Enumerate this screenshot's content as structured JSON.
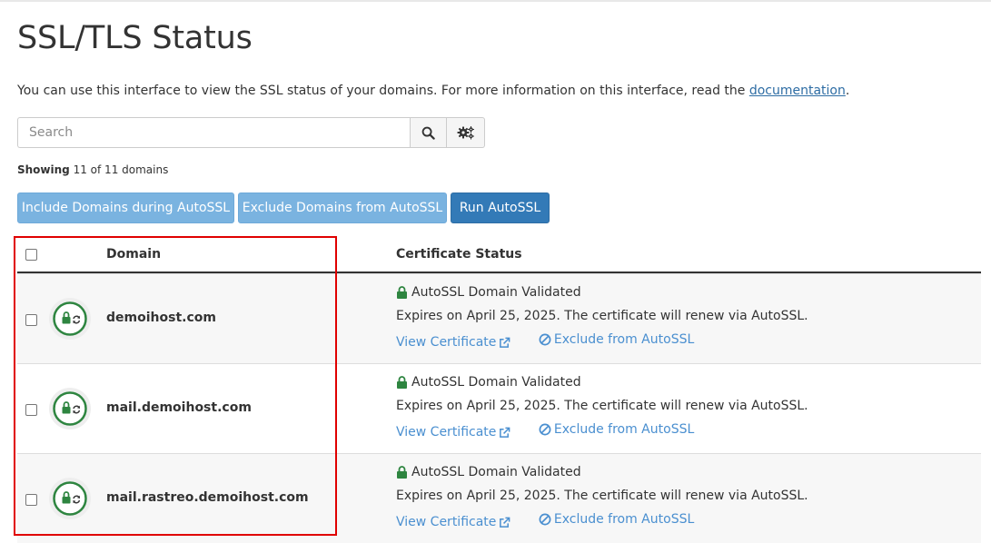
{
  "page": {
    "title": "SSL/TLS Status",
    "intro_text": "You can use this interface to view the SSL status of your domains. For more information on this interface, read the ",
    "intro_link": "documentation",
    "intro_end": "."
  },
  "search": {
    "placeholder": "Search",
    "search_icon": "search-icon",
    "settings_icon": "gears-icon"
  },
  "showing": {
    "label": "Showing",
    "count_text": "11 of 11 domains"
  },
  "actions": {
    "include": "Include Domains during AutoSSL",
    "exclude": "Exclude Domains from AutoSSL",
    "run": "Run AutoSSL"
  },
  "table": {
    "col_domain": "Domain",
    "col_status": "Certificate Status",
    "rows": [
      {
        "domain": "demoihost.com",
        "status": "AutoSSL Domain Validated",
        "expires": "Expires on April 25, 2025. The certificate will renew via AutoSSL.",
        "view_link": "View Certificate",
        "exclude_link": "Exclude from AutoSSL"
      },
      {
        "domain": "mail.demoihost.com",
        "status": "AutoSSL Domain Validated",
        "expires": "Expires on April 25, 2025. The certificate will renew via AutoSSL.",
        "view_link": "View Certificate",
        "exclude_link": "Exclude from AutoSSL"
      },
      {
        "domain": "mail.rastreo.demoihost.com",
        "status": "AutoSSL Domain Validated",
        "expires": "Expires on April 25, 2025. The certificate will renew via AutoSSL.",
        "view_link": "View Certificate",
        "exclude_link": "Exclude from AutoSSL"
      }
    ]
  },
  "colors": {
    "primary": "#337ab7",
    "light_button": "#7ab3e0",
    "link": "#4a8fd0",
    "valid_green": "#2e8540",
    "highlight": "#e00000"
  }
}
